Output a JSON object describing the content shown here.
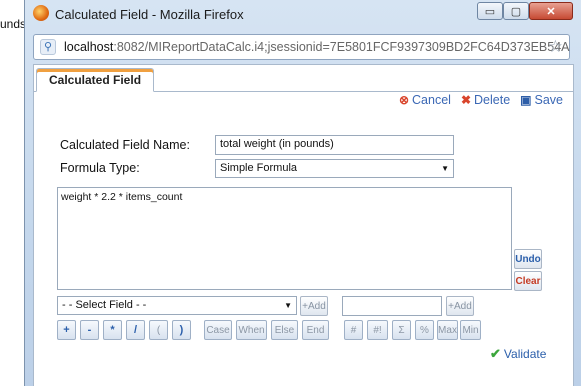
{
  "background_text": "unds",
  "window": {
    "title": "Calculated Field - Mozilla Firefox",
    "controls": {
      "minimize": "▭",
      "maximize": "▢",
      "close": "✕"
    }
  },
  "addressbar": {
    "host": "localhost",
    "path": ":8082/MIReportDataCalc.i4;jsessionid=7E5801FCF9397309BD2FC64D373EB54A"
  },
  "tab": {
    "label": "Calculated Field"
  },
  "actions": {
    "cancel": "Cancel",
    "delete": "Delete",
    "save": "Save"
  },
  "form": {
    "name_label": "Calculated Field Name:",
    "name_value": "total weight (in pounds)",
    "type_label": "Formula Type:",
    "type_value": "Simple Formula",
    "formula": "weight * 2.2 * items_count"
  },
  "editor_buttons": {
    "undo": "Undo",
    "clear": "Clear"
  },
  "field_row": {
    "select_placeholder": "- - Select Field - -",
    "add1": "+Add",
    "add2": "+Add"
  },
  "operators": [
    {
      "label": "+",
      "enabled": true
    },
    {
      "label": "-",
      "enabled": true
    },
    {
      "label": "*",
      "enabled": true
    },
    {
      "label": "/",
      "enabled": true
    },
    {
      "label": "(",
      "enabled": false
    },
    {
      "label": ")",
      "enabled": true
    },
    {
      "label": "Case",
      "enabled": false
    },
    {
      "label": "When",
      "enabled": false
    },
    {
      "label": "Else",
      "enabled": false
    },
    {
      "label": "End",
      "enabled": false
    },
    {
      "label": "#",
      "enabled": false
    },
    {
      "label": "#!",
      "enabled": false
    },
    {
      "label": "Σ",
      "enabled": false
    },
    {
      "label": "%",
      "enabled": false
    },
    {
      "label": "Max",
      "enabled": false
    },
    {
      "label": "Min",
      "enabled": false
    }
  ],
  "validate": "Validate",
  "colors": {
    "accent": "#3b68b5",
    "danger": "#d9452c",
    "success": "#3ca63c"
  }
}
